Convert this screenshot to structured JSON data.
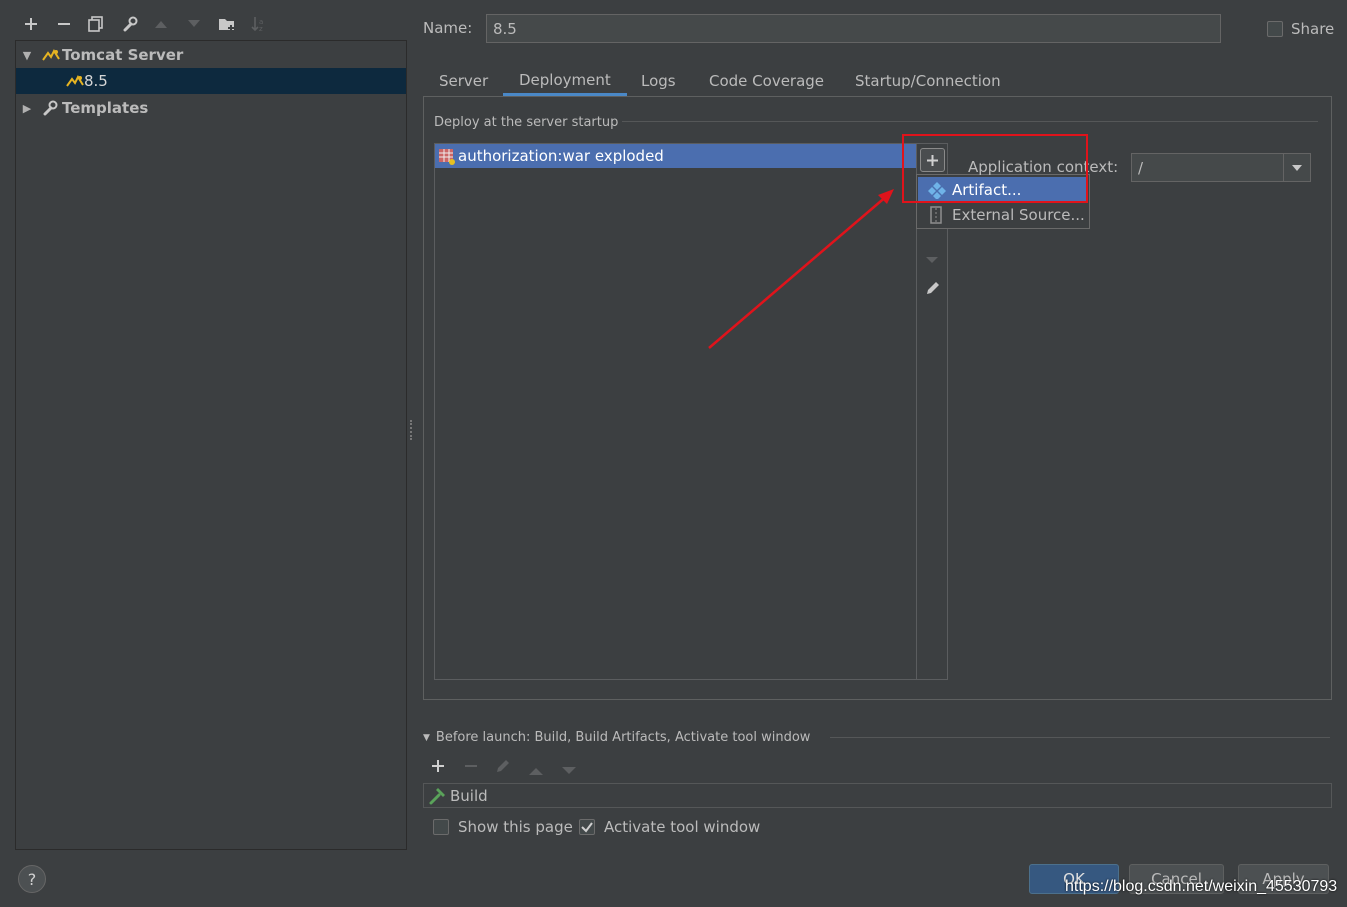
{
  "toolbar": {
    "icons": [
      "add-icon",
      "remove-icon",
      "copy-icon",
      "wrench-icon",
      "move-up-icon",
      "move-down-icon",
      "folder-add-icon",
      "sort-icon"
    ]
  },
  "tree": {
    "tomcat_label": "Tomcat Server",
    "child_label": "8.5",
    "templates_label": "Templates"
  },
  "name_field": {
    "label": "Name:",
    "value": "8.5"
  },
  "share": {
    "label": "Share"
  },
  "tabs": [
    "Server",
    "Deployment",
    "Logs",
    "Code Coverage",
    "Startup/Connection"
  ],
  "deployment": {
    "section_label": "Deploy at the server startup",
    "item_label": "authorization:war exploded",
    "app_context_label": "Application context:",
    "app_context_value": "/"
  },
  "popup": {
    "artifact_label": "Artifact...",
    "external_label": "External Source..."
  },
  "before_launch": {
    "label": "Before launch: Build, Build Artifacts, Activate tool window",
    "build_label": "Build",
    "show_page_label": "Show this page",
    "activate_label": "Activate tool window"
  },
  "buttons": {
    "ok": "OK",
    "cancel": "Cancel",
    "apply": "Apply",
    "help": "?"
  },
  "watermark": "https://blog.csdn.net/weixin_45530793",
  "colors": {
    "accent": "#4a88c7",
    "selection": "#4b6eaf",
    "annotation": "#e0131b"
  }
}
